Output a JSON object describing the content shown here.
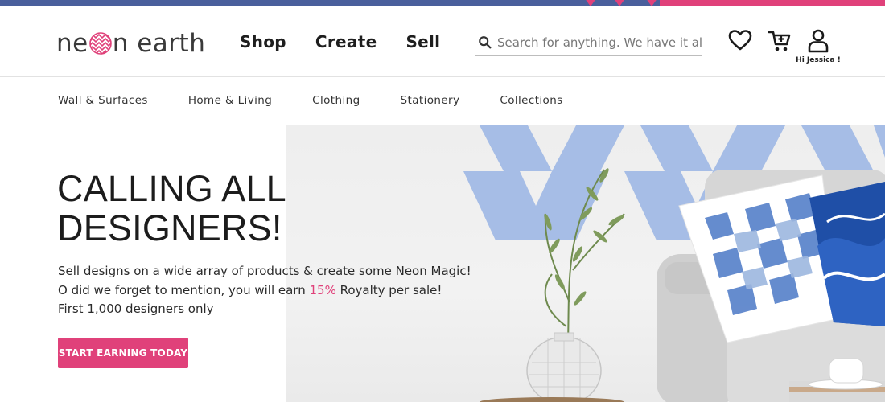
{
  "brand": {
    "logo_text_left": "ne",
    "logo_text_right": "n earth",
    "pink": "#e0417a",
    "navy": "#4a5f9c"
  },
  "header": {
    "nav": [
      "Shop",
      "Create",
      "Sell"
    ],
    "search_placeholder": "Search for anything. We have it all!",
    "greeting": "Hi Jessica !",
    "icons": [
      "search-icon",
      "heart-icon",
      "cart-icon",
      "user-icon"
    ]
  },
  "subnav": [
    "Wall & Surfaces",
    "Home & Living",
    "Clothing",
    "Stationery",
    "Collections"
  ],
  "hero": {
    "title_line1": "CALLING ALL",
    "title_line2": "DESIGNERS!",
    "line1": "Sell designs on a wide array of products & create some Neon Magic!",
    "line2_before": "O did we forget to mention, you will earn ",
    "line2_highlight": "15%",
    "line2_after": " Royalty per sale!",
    "line3": "First 1,000 designers only",
    "cta": "START EARNING TODAY"
  }
}
